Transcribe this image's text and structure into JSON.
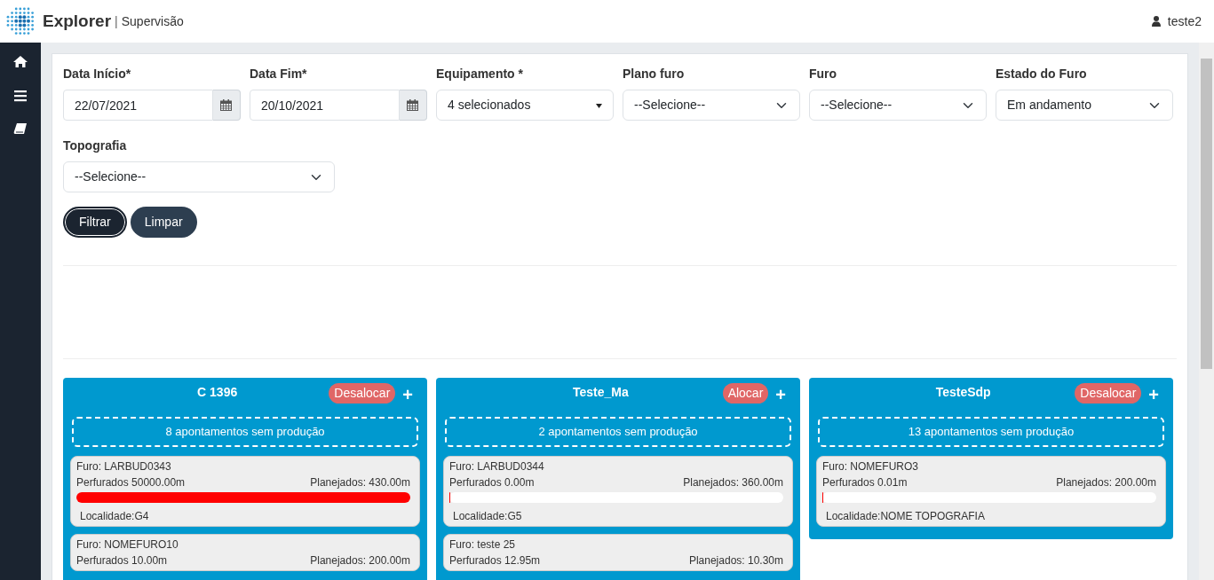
{
  "header": {
    "app_name": "Explorer",
    "separator": "|",
    "section": "Supervisão",
    "user": "teste2"
  },
  "sidebar": {
    "items": [
      {
        "kind": "home"
      },
      {
        "kind": "menu"
      },
      {
        "kind": "book"
      }
    ]
  },
  "filters": [
    {
      "kind": "date",
      "label": "Data Início*",
      "value": "22/07/2021"
    },
    {
      "kind": "date",
      "label": "Data Fim*",
      "value": "20/10/2021"
    },
    {
      "kind": "multiselect",
      "label": "Equipamento *",
      "value": "4 selecionados"
    },
    {
      "kind": "select",
      "label": "Plano furo",
      "value": "--Selecione--"
    },
    {
      "kind": "select",
      "label": "Furo",
      "value": "--Selecione--"
    },
    {
      "kind": "select",
      "label": "Estado do Furo",
      "value": "Em andamento"
    },
    {
      "kind": "select",
      "label": "Topografia",
      "value": "--Selecione--"
    }
  ],
  "buttons": [
    {
      "label": "Filtrar",
      "kind": "primary"
    },
    {
      "label": "Limpar",
      "kind": "secondary"
    }
  ],
  "equipment": [
    {
      "name": "C 1396",
      "action": "Desalocar",
      "plus": "+",
      "pending": "8 apontamentos sem produção",
      "holes": [
        {
          "furo_label": "Furo:",
          "furo": "LARBUD0343",
          "drilled": "Perfurados 50000.00m",
          "planned": "Planejados: 430.00m",
          "level": 1,
          "location_label": "Localidade:",
          "location": "G4"
        },
        {
          "furo_label": "Furo:",
          "furo": "NOMEFURO10",
          "drilled": "Perfurados 10.00m",
          "planned": "Planejados: 200.00m"
        }
      ]
    },
    {
      "name": "Teste_Ma",
      "action": "Alocar",
      "plus": "+",
      "pending": "2 apontamentos sem produção",
      "holes": [
        {
          "furo_label": "Furo:",
          "furo": "LARBUD0344",
          "drilled": "Perfurados 0.00m",
          "planned": "Planejados: 360.00m",
          "level": 0,
          "location_label": "Localidade:",
          "location": "G5"
        },
        {
          "furo_label": "Furo:",
          "furo": "teste 25",
          "drilled": "Perfurados 12.95m",
          "planned": "Planejados: 10.30m"
        }
      ]
    },
    {
      "name": "TesteSdp",
      "action": "Desalocar",
      "plus": "+",
      "pending": "13 apontamentos sem produção",
      "holes": [
        {
          "furo_label": "Furo:",
          "furo": "NOMEFURO3",
          "drilled": "Perfurados 0.01m",
          "planned": "Planejados: 200.00m",
          "level": 0,
          "location_label": "Localidade:",
          "location": "NOME TOPOGRAFIA"
        }
      ]
    }
  ]
}
